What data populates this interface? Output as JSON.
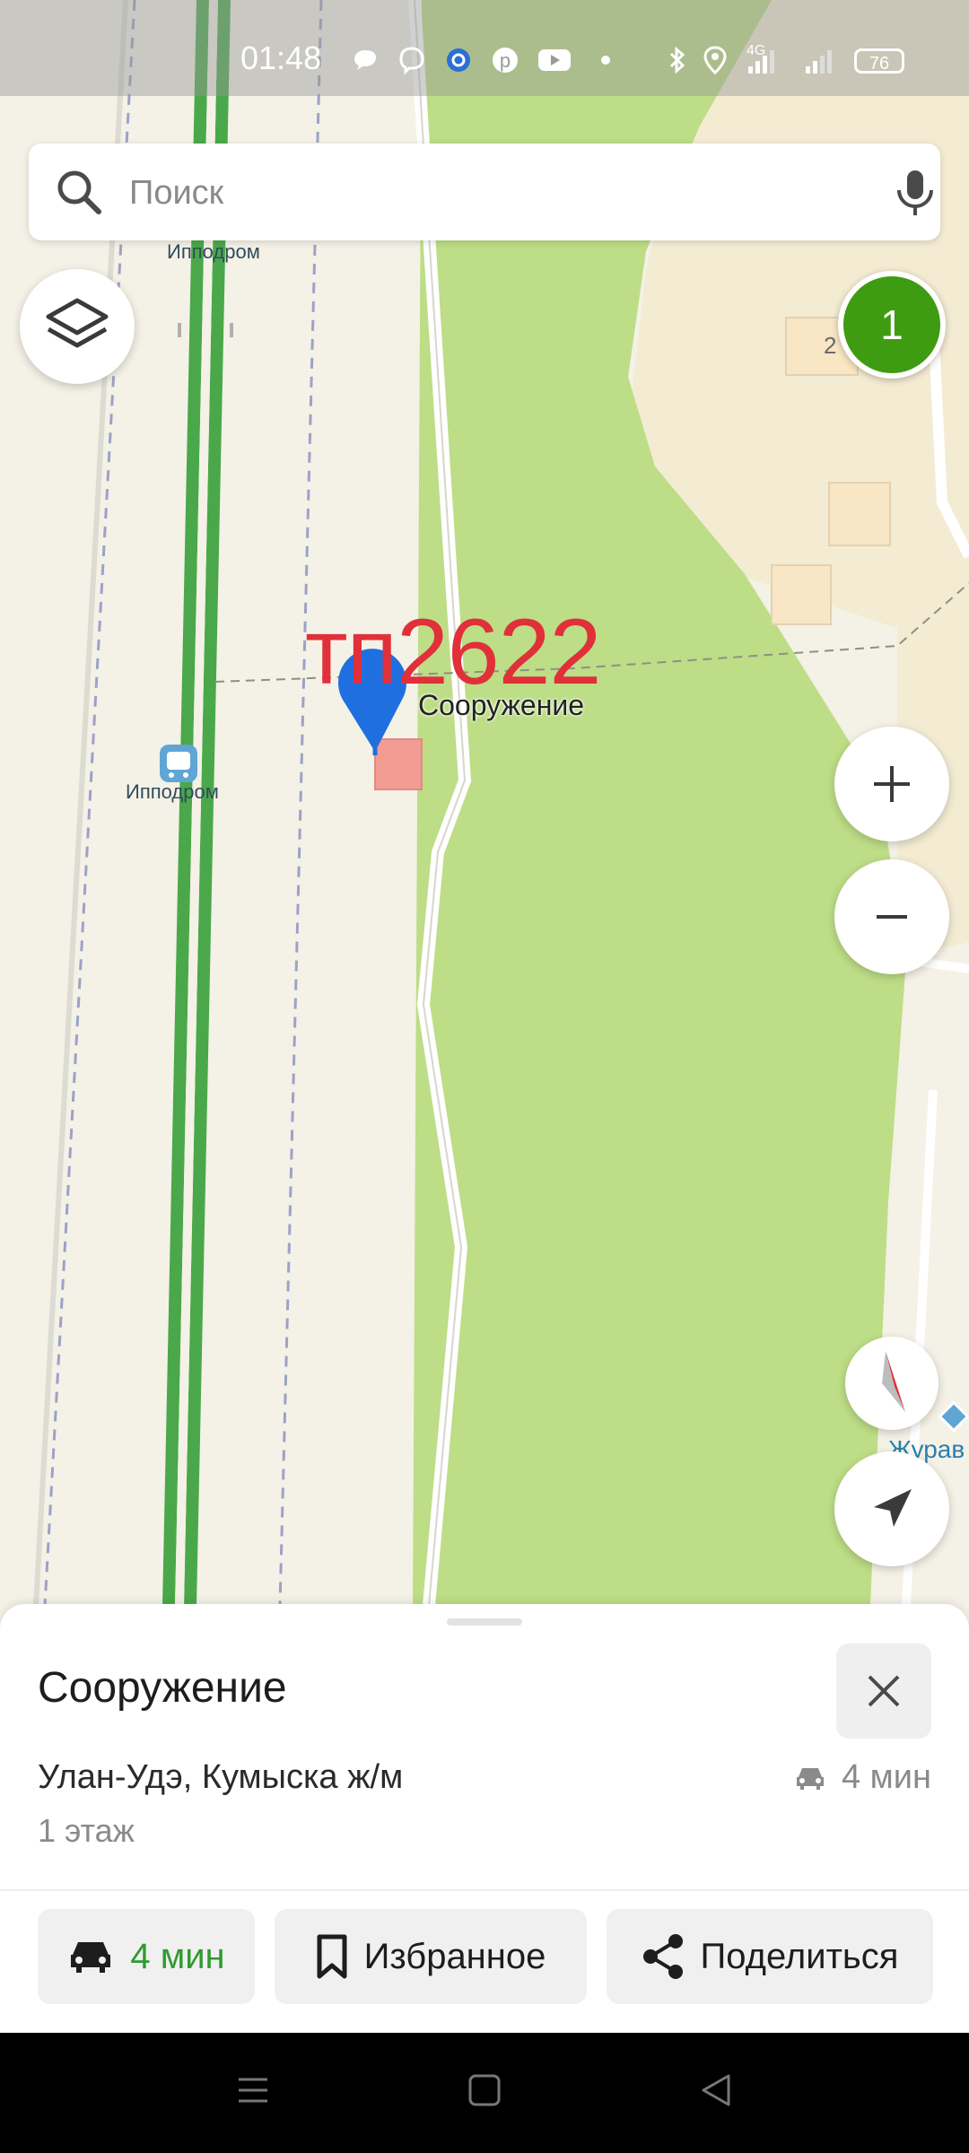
{
  "status_bar": {
    "time": "01:48",
    "network_label": "4G",
    "battery": "76"
  },
  "search": {
    "placeholder": "Поиск"
  },
  "map": {
    "label_ippodrom_top": "Ипподром",
    "label_ippodrom_stop": "Ипподром",
    "label_building_num": "2",
    "label_tp": "тп2622",
    "label_structure": "Сооружение",
    "label_zhurav": "Журав",
    "cluster_count": "1"
  },
  "sheet": {
    "title": "Сооружение",
    "address": "Улан-Удэ, Кумыска ж/м",
    "floors": "1 этаж",
    "eta": "4 мин"
  },
  "actions": {
    "route_label": "4 мин",
    "favorite_label": "Избранное",
    "share_label": "Поделиться"
  },
  "colors": {
    "accent_green": "#2e9b2e",
    "park_green": "#bddd86",
    "marker_blue": "#1f6fe0",
    "tp_red": "#e0303a"
  }
}
